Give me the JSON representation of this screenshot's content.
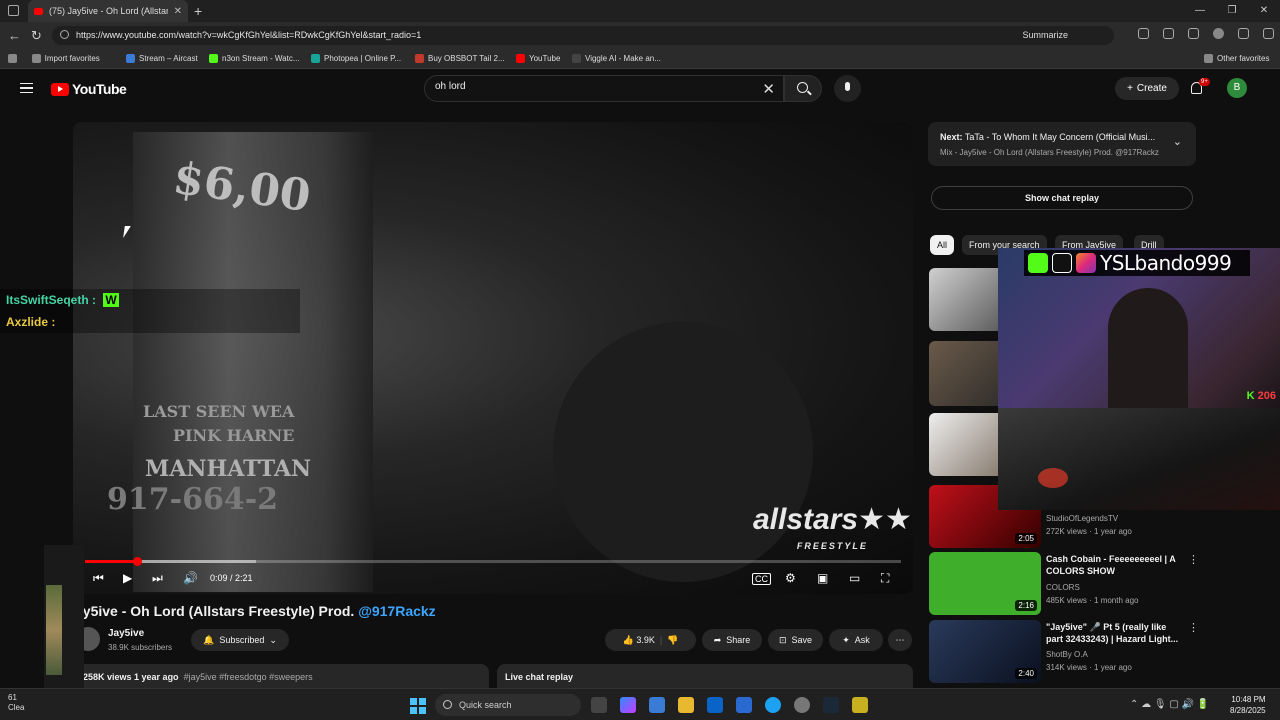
{
  "browser": {
    "tab_title": "(75) Jay5ive - Oh Lord (Allstars Fr...",
    "url": "https://www.youtube.com/watch?v=wkCgKfGhYel&list=RDwkCgKfGhYel&start_radio=1",
    "summarize_label": "Summarize",
    "bookmarks": [
      {
        "label": "Import favorites",
        "color": "#888888"
      },
      {
        "label": "Stream – Aircast",
        "color": "#3a7bd5"
      },
      {
        "label": "n3on Stream - Watc...",
        "color": "#53fc18"
      },
      {
        "label": "Photopea | Online P...",
        "color": "#18a497"
      },
      {
        "label": "Buy OBSBOT Tail 2...",
        "color": "#c0392b"
      },
      {
        "label": "YouTube",
        "color": "#ff0000"
      },
      {
        "label": "Viggle AI - Make an...",
        "color": "#444444"
      }
    ],
    "other_favorites": "Other favorites"
  },
  "youtube": {
    "logo_text": "YouTube",
    "search_value": "oh lord",
    "create_label": "Create",
    "notif_badge": "9+",
    "avatar_letter": "B"
  },
  "player": {
    "poster_text_1": "$6,00",
    "poster_text_2": "LAST SEEN WEA",
    "poster_text_3": "PINK HARNE",
    "poster_text_4": "MANHATTAN",
    "poster_text_5": "917-664-2",
    "watermark": "allstars",
    "watermark_sub": "FREESTYLE",
    "time": "0:09 / 2:21",
    "progress": 0.064,
    "buffered": 0.21
  },
  "chat_overlay": [
    {
      "user": "ItsSwiftSeqeth :",
      "msg": "W",
      "user_color": "#44d4a5"
    },
    {
      "user": "Axzlide :",
      "msg": "",
      "user_color": "#e8c840"
    }
  ],
  "video": {
    "title": "ay5ive - Oh Lord (Allstars Freestyle) Prod.",
    "title_handle": "@917Rackz",
    "channel": "Jay5ive",
    "subscribers": "38.9K subscribers",
    "subscribed_label": "Subscribed",
    "likes": "3.9K",
    "share_label": "Share",
    "save_label": "Save",
    "ask_label": "Ask",
    "views": "258K views  1 year ago",
    "tags": "#jay5ive #freesdotgo #sweepers",
    "live_chat_replay": "Live chat replay"
  },
  "sidebar": {
    "next_prefix": "Next:",
    "next_title": "TaTa - To Whom It May Concern (Official Musi...",
    "mix_title": "Mix - Jay5ive - Oh Lord (Allstars Freestyle) Prod. @917Rackz",
    "show_chat_replay": "Show chat replay",
    "chips": [
      "All",
      "From your search",
      "From Jay5ive",
      "Drill"
    ],
    "items": [
      {
        "title": "",
        "channel": "StudioOfLegendsTV",
        "meta": "272K views · 1 year ago",
        "duration": "2:05"
      },
      {
        "title": "Cash Cobain - Feeeeeeeeel | A COLORS SHOW",
        "channel": "COLORS",
        "meta": "485K views · 1 month ago",
        "duration": "2:16"
      },
      {
        "title": "\"Jay5ive\" 🎤 Pt 5 (really like part 32433243) | Hazard Light...",
        "channel": "ShotBy O.A",
        "meta": "314K views · 1 year ago",
        "duration": "2:40"
      }
    ]
  },
  "webcam": {
    "username": "YSLbando999",
    "viewer_count": "206"
  },
  "taskbar": {
    "weather_temp": "61",
    "weather_desc": "Clea",
    "search_placeholder": "Quick search",
    "time": "10:48 PM",
    "date": "8/28/2025"
  }
}
